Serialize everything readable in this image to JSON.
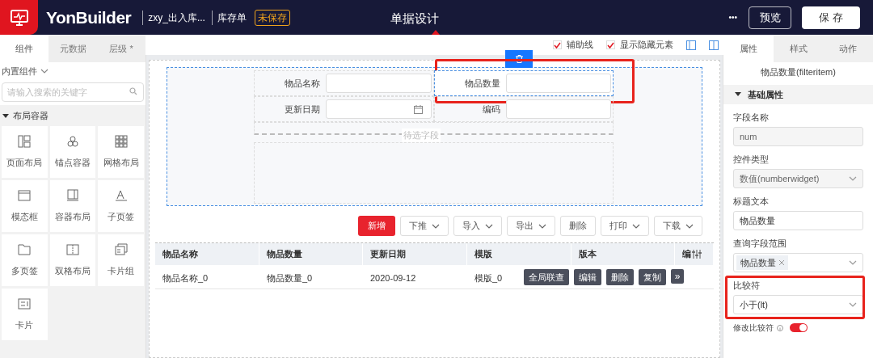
{
  "header": {
    "brand": "YonBuilder",
    "app_name": "zxy_出入库...",
    "doc_name": "库存单",
    "save_state": "未保存",
    "title": "单据设计",
    "more": "•••",
    "buttons": [
      {
        "label": "预览",
        "kind": "outline"
      },
      {
        "label": "保 存",
        "kind": "solid"
      }
    ]
  },
  "left_panel": {
    "tabs": [
      {
        "label": "组件",
        "selected": true
      },
      {
        "label": "元数据",
        "selected": false
      },
      {
        "label": "层级 *",
        "selected": false
      }
    ],
    "source": "内置组件",
    "search": {
      "placeholder": "请输入搜索的关键字"
    },
    "group": {
      "label": "布局容器",
      "expanded": true,
      "items": [
        {
          "label": "页面布局",
          "kind": "page"
        },
        {
          "label": "锚点容器",
          "kind": "anchor"
        },
        {
          "label": "网格布局",
          "kind": "grid"
        },
        {
          "label": "模态框",
          "kind": "modal"
        },
        {
          "label": "容器布局",
          "kind": "container"
        },
        {
          "label": "子页签",
          "kind": "subtab"
        },
        {
          "label": "多页签",
          "kind": "tabs"
        },
        {
          "label": "双格布局",
          "kind": "split"
        },
        {
          "label": "卡片组",
          "kind": "cardgroup"
        },
        {
          "label": "卡片",
          "kind": "card"
        }
      ]
    }
  },
  "canvas": {
    "options": [
      {
        "label": "辅助线",
        "checked": true
      },
      {
        "label": "显示隐藏元素",
        "checked": true
      }
    ],
    "filters": [
      {
        "label": "物品名称",
        "kind": "text",
        "selected": false
      },
      {
        "label": "物品数量",
        "kind": "text",
        "selected": true
      },
      {
        "label": "更新日期",
        "kind": "date",
        "selected": false
      },
      {
        "label": "编码",
        "kind": "text",
        "selected": false
      }
    ],
    "pending": "待选字段",
    "toolbar": [
      {
        "label": "新增",
        "kind": "primary",
        "dropdown": false
      },
      {
        "label": "下推",
        "kind": "default",
        "dropdown": true
      },
      {
        "label": "导入",
        "kind": "default",
        "dropdown": true
      },
      {
        "label": "导出",
        "kind": "default",
        "dropdown": true
      },
      {
        "label": "删除",
        "kind": "plain",
        "dropdown": false
      },
      {
        "label": "打印",
        "kind": "default",
        "dropdown": true
      },
      {
        "label": "下载",
        "kind": "default",
        "dropdown": true
      }
    ],
    "table": {
      "columns": [
        "物品名称",
        "物品数量",
        "更新日期",
        "模版",
        "版本",
        "编"
      ],
      "rows": [
        [
          "物品名称_0",
          "物品数量_0",
          "2020-09-12",
          "模版_0"
        ]
      ],
      "row_actions": [
        "全局联查",
        "编辑",
        "删除",
        "复制"
      ],
      "more": "»"
    }
  },
  "right_panel": {
    "tabs": [
      {
        "label": "属性",
        "selected": true
      },
      {
        "label": "样式",
        "selected": false
      },
      {
        "label": "动作",
        "selected": false
      }
    ],
    "title": "物品数量(filteritem)",
    "section": "基础属性",
    "fields": [
      {
        "label": "字段名称",
        "kind": "readonly",
        "value": "num",
        "highlighted": false
      },
      {
        "label": "控件类型",
        "kind": "select",
        "value": "数值(numberwidget)",
        "disabled": true,
        "highlighted": false
      },
      {
        "label": "标题文本",
        "kind": "input",
        "value": "物品数量",
        "highlighted": false
      },
      {
        "label": "查询字段范围",
        "kind": "tags",
        "tags": [
          "物品数量"
        ],
        "highlighted": false
      },
      {
        "label": "比较符",
        "kind": "select",
        "value": "小于(lt)",
        "disabled": false,
        "highlighted": true
      }
    ],
    "toggle": {
      "label": "修改比较符",
      "on": true
    }
  }
}
